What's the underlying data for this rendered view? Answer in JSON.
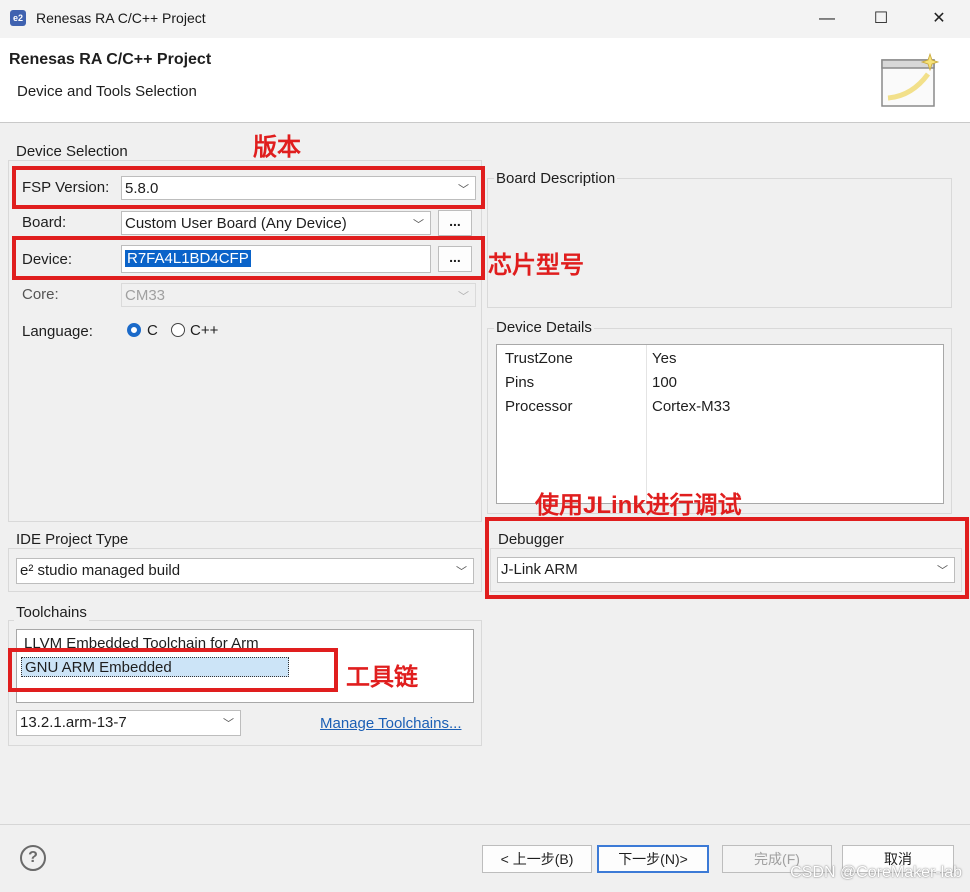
{
  "window": {
    "app_icon": "e2",
    "title": "Renesas RA C/C++ Project",
    "minimize": "—",
    "maximize": "☐",
    "close": "✕"
  },
  "header": {
    "title": "Renesas RA C/C++ Project",
    "subtitle": "Device and Tools Selection"
  },
  "device_selection": {
    "group_label": "Device Selection",
    "fsp_label": "FSP Version:",
    "fsp_value": "5.8.0",
    "board_label": "Board:",
    "board_value": "Custom User Board (Any Device)",
    "browse_label": "...",
    "device_label": "Device:",
    "device_value": "R7FA4L1BD4CFP",
    "core_label": "Core:",
    "core_value": "CM33",
    "language_label": "Language:",
    "lang_c": "C",
    "lang_cpp": "C++",
    "lang_selected": "C"
  },
  "board_description": {
    "group_label": "Board Description"
  },
  "device_details": {
    "group_label": "Device Details",
    "rows": [
      {
        "key": "TrustZone",
        "value": "Yes"
      },
      {
        "key": "Pins",
        "value": "100"
      },
      {
        "key": "Processor",
        "value": "Cortex-M33"
      }
    ]
  },
  "ide_project_type": {
    "group_label": "IDE Project Type",
    "value": "e² studio managed build"
  },
  "debugger": {
    "group_label": "Debugger",
    "value": "J-Link ARM"
  },
  "toolchains": {
    "group_label": "Toolchains",
    "items": [
      "LLVM Embedded Toolchain for Arm",
      "GNU ARM Embedded"
    ],
    "selected": "GNU ARM Embedded",
    "version": "13.2.1.arm-13-7",
    "manage_link": "Manage Toolchains..."
  },
  "annotations": {
    "version": "版本",
    "chip_model": "芯片型号",
    "debug_jlink": "使用JLink进行调试",
    "toolchain": "工具链",
    "color": "#e01e1e"
  },
  "footer": {
    "help": "?",
    "back": "< 上一步(B)",
    "next": "下一步(N)>",
    "finish": "完成(F)",
    "cancel": "取消"
  },
  "watermark": "CSDN @CoreMaker-lab",
  "colors": {
    "selection": "#0a63c9",
    "accent": "#1b6ac9",
    "link": "#1b5fb5"
  }
}
